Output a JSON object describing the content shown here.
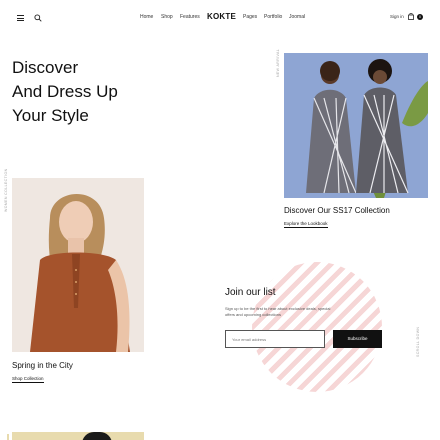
{
  "header": {
    "nav": [
      "Home",
      "Shop",
      "Features",
      "Pages",
      "Portfolio",
      "Joomal"
    ],
    "logo": "KOKTE",
    "signin": "Sign in",
    "cart_count": "0",
    "icons": [
      "hamburger-menu-icon",
      "search-icon",
      "shopping-bag-icon"
    ]
  },
  "hero": {
    "line1": "Discover",
    "line2": "And Dress Up",
    "line3": "Your Style"
  },
  "labels": {
    "top": "NEW ARRIVAL",
    "left": "WOMEN COLLECTION",
    "scroll": "SCROLL DOWN"
  },
  "featured": {
    "caption": "Discover Our SS17 Collection",
    "link": "Explore the Lookbook"
  },
  "spring": {
    "caption": "Spring in the City",
    "link": "Shop Collection"
  },
  "newsletter": {
    "title": "Join our list",
    "description": "Sign up to be the first to hear about exclusive deals, special offers and upcoming collections",
    "email_placeholder": "Your email address",
    "subscribe_label": "Subscribe"
  },
  "colors": {
    "accent_pink": "#f6d6d6",
    "dark": "#111111"
  }
}
